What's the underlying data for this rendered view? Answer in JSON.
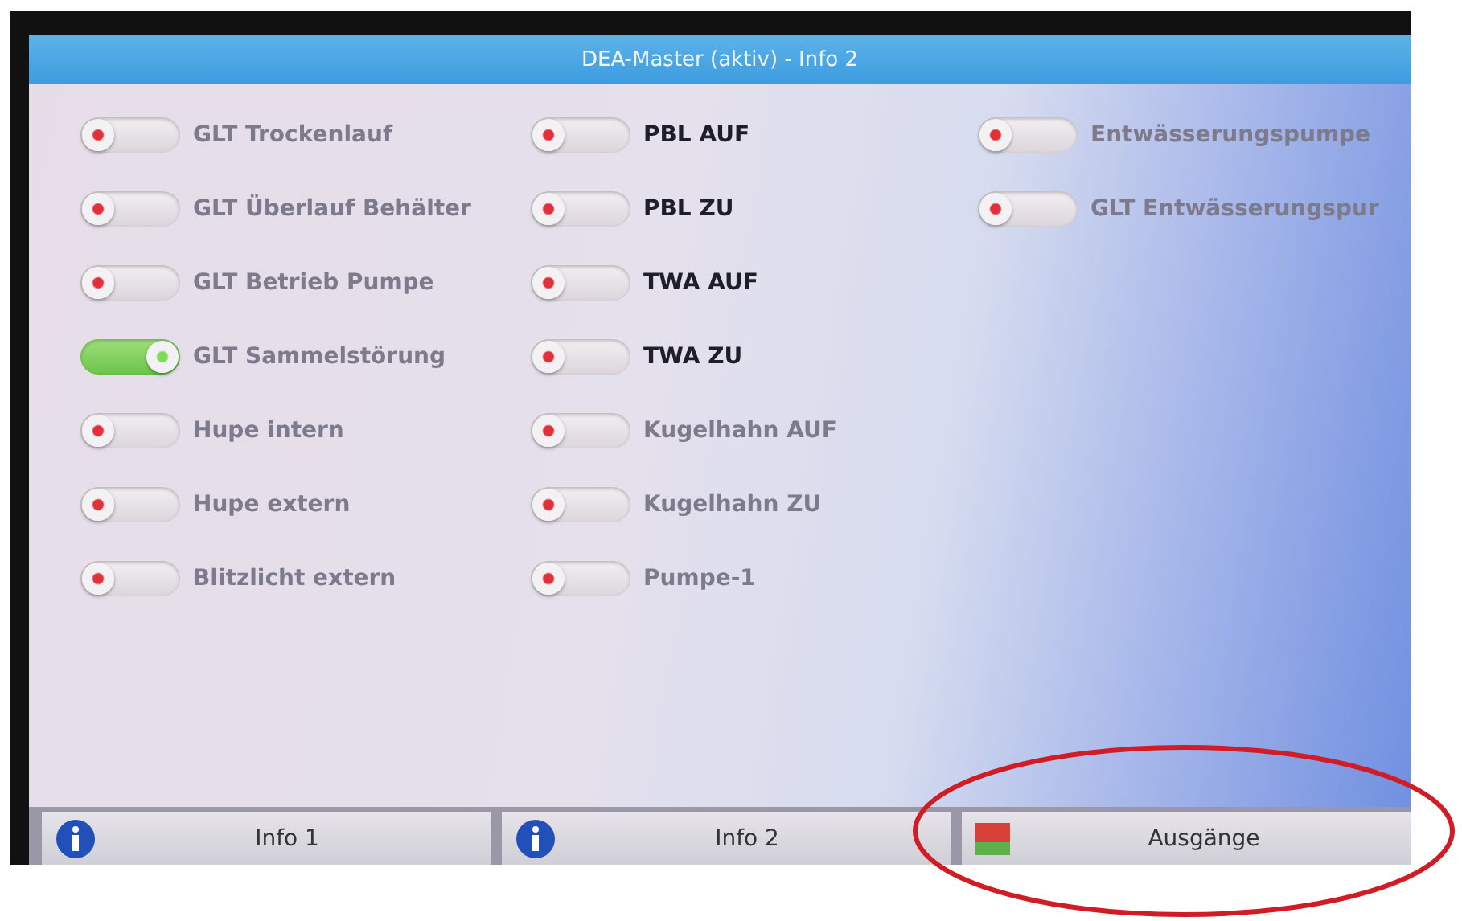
{
  "window": {
    "title": "DEA-Master (aktiv) - Info 2"
  },
  "columns": [
    {
      "items": [
        {
          "label": "GLT Trockenlauf",
          "on": false,
          "disabled": true
        },
        {
          "label": "GLT Überlauf Behälter",
          "on": false,
          "disabled": true
        },
        {
          "label": "GLT Betrieb Pumpe",
          "on": false,
          "disabled": true
        },
        {
          "label": "GLT Sammelstörung",
          "on": true,
          "disabled": true
        },
        {
          "label": "Hupe intern",
          "on": false,
          "disabled": true
        },
        {
          "label": "Hupe extern",
          "on": false,
          "disabled": true
        },
        {
          "label": "Blitzlicht extern",
          "on": false,
          "disabled": true
        }
      ]
    },
    {
      "items": [
        {
          "label": "PBL AUF",
          "on": false,
          "disabled": false
        },
        {
          "label": "PBL ZU",
          "on": false,
          "disabled": false
        },
        {
          "label": "TWA AUF",
          "on": false,
          "disabled": false
        },
        {
          "label": "TWA ZU",
          "on": false,
          "disabled": false
        },
        {
          "label": "Kugelhahn AUF",
          "on": false,
          "disabled": true
        },
        {
          "label": "Kugelhahn ZU",
          "on": false,
          "disabled": true
        },
        {
          "label": "Pumpe-1",
          "on": false,
          "disabled": true
        }
      ]
    },
    {
      "items": [
        {
          "label": "Entwässerungspumpe",
          "on": false,
          "disabled": true
        },
        {
          "label": "GLT Entwässerungspur",
          "on": false,
          "disabled": true
        }
      ]
    }
  ],
  "buttons": [
    {
      "label": "Info 1",
      "kind": "info"
    },
    {
      "label": "Info 2",
      "kind": "info"
    },
    {
      "label": "Ausgänge",
      "kind": "outputs"
    }
  ]
}
